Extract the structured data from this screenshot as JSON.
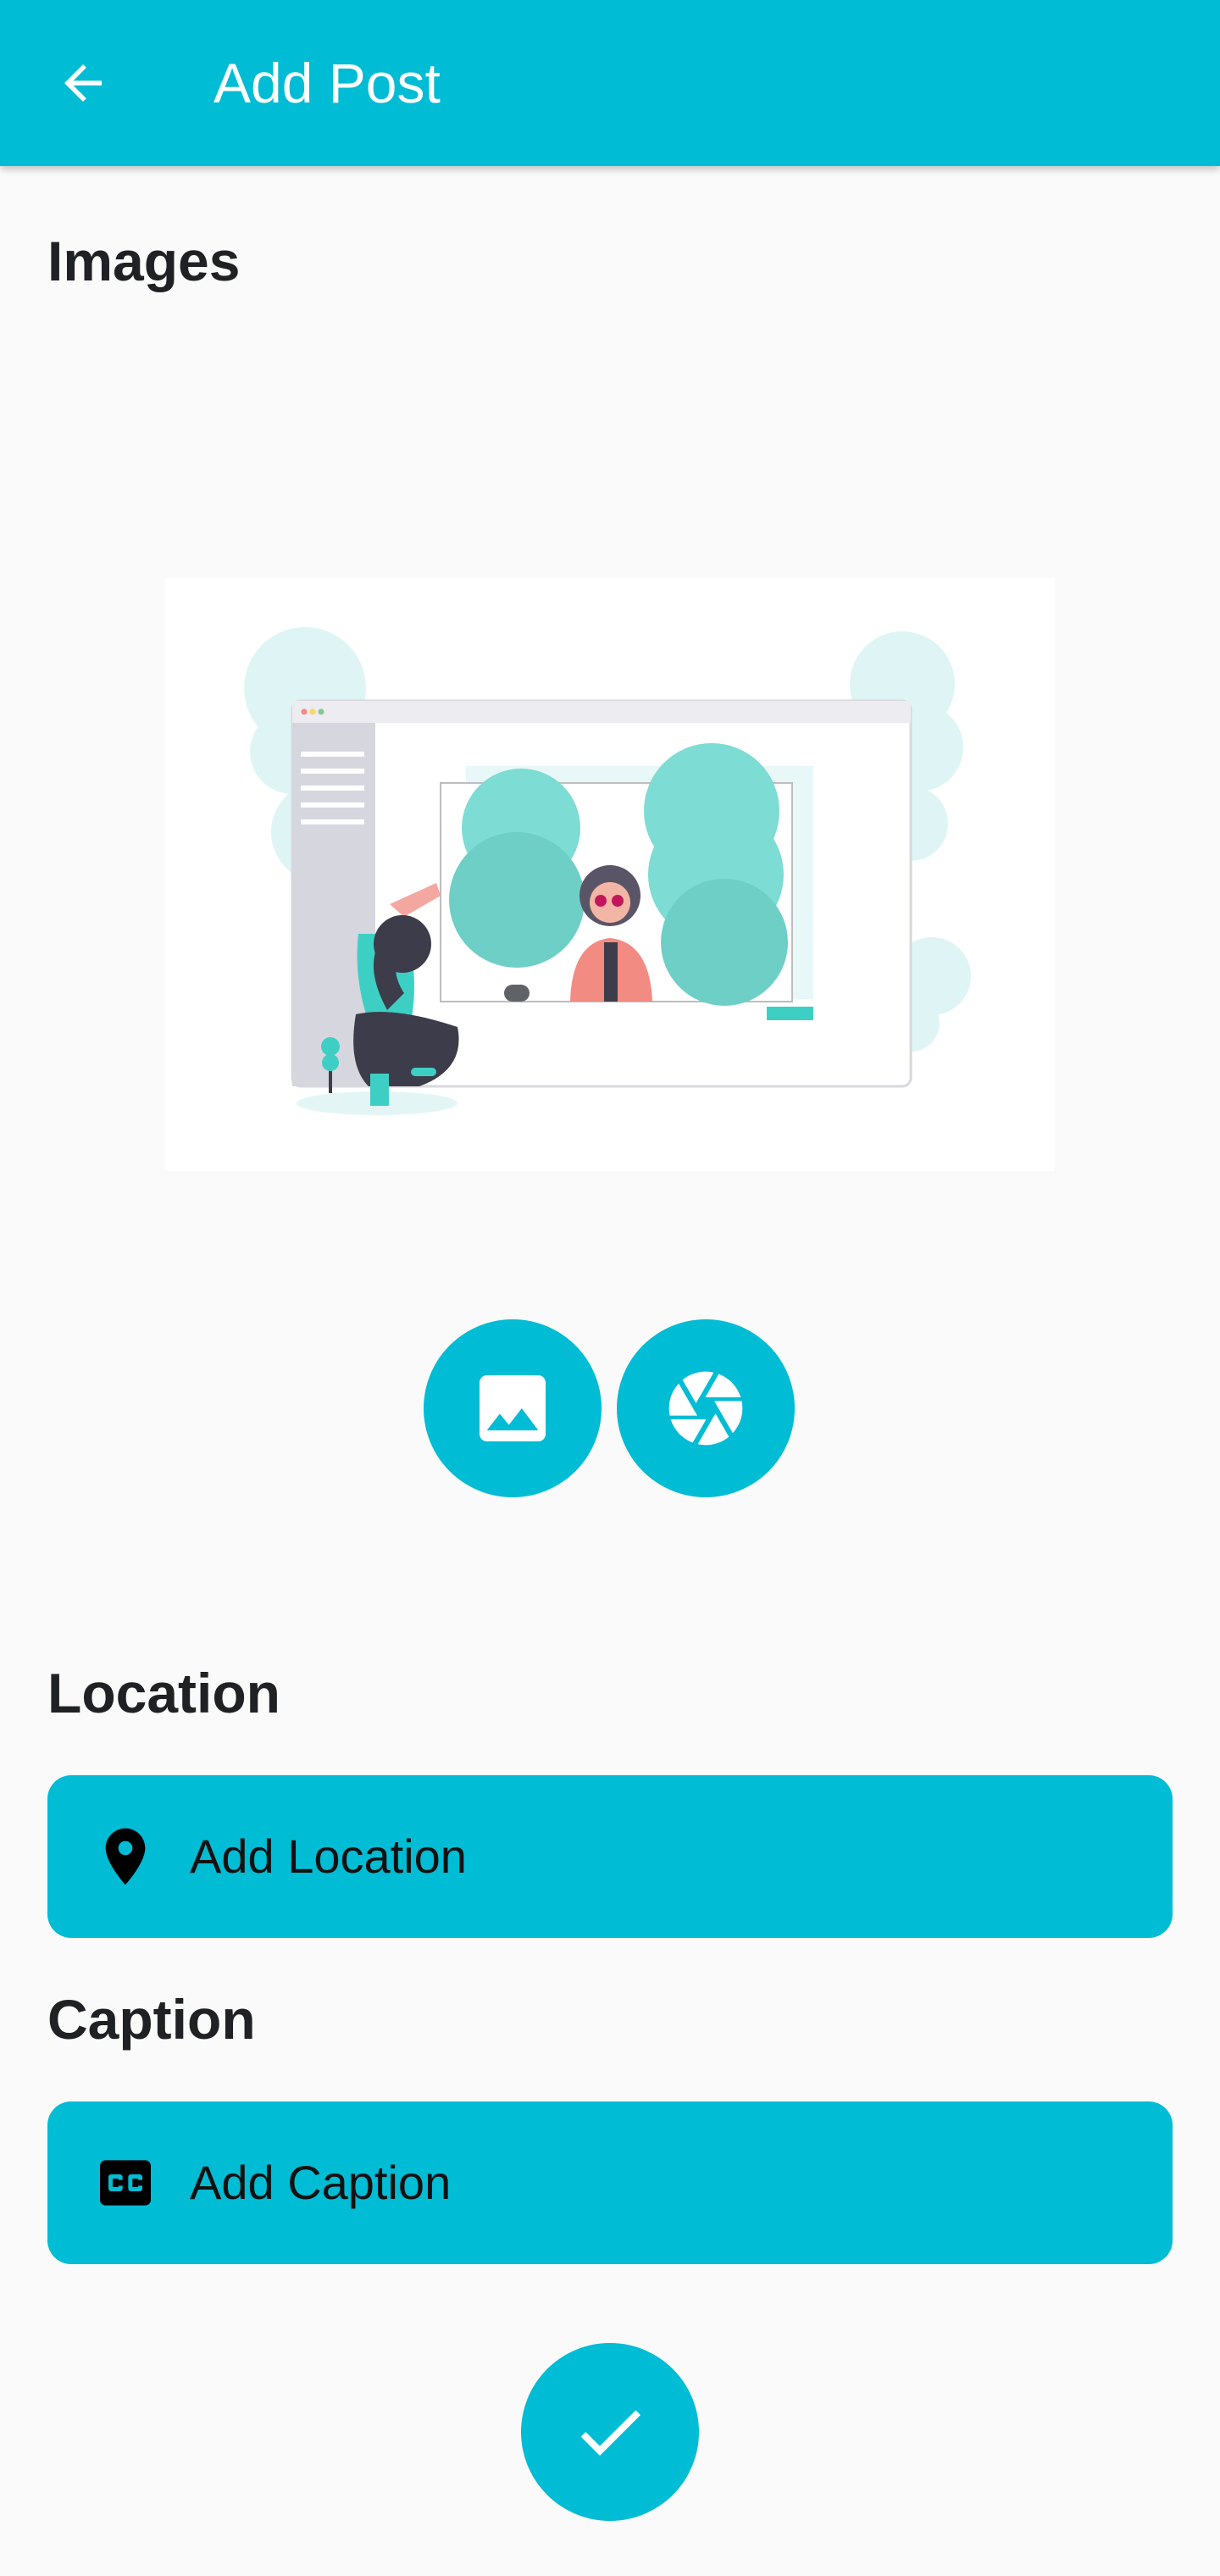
{
  "appbar": {
    "title": "Add Post",
    "back_icon": "arrow-back-icon",
    "background": "#00bcd4"
  },
  "images_section": {
    "label": "Images",
    "gallery_icon": "image-icon",
    "camera_icon": "camera-aperture-icon"
  },
  "location_section": {
    "label": "Location",
    "button_label": "Add Location",
    "icon": "location-pin-icon"
  },
  "caption_section": {
    "label": "Caption",
    "button_label": "Add Caption",
    "icon": "closed-caption-icon"
  },
  "submit": {
    "icon": "check-icon"
  },
  "colors": {
    "accent": "#00bcd4",
    "background": "#fafafa",
    "text": "#202124"
  }
}
